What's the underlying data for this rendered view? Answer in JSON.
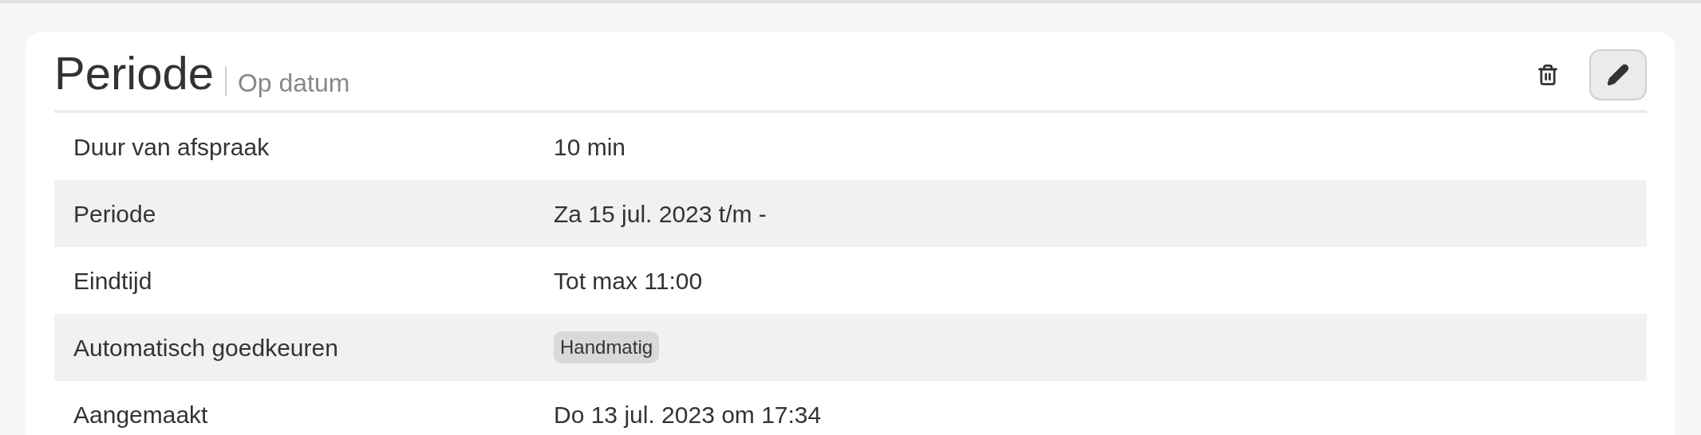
{
  "card": {
    "title": "Periode",
    "subtitle": "Op datum"
  },
  "rows": [
    {
      "label": "Duur van afspraak",
      "kind": "text",
      "value": "10 min"
    },
    {
      "label": "Periode",
      "kind": "text",
      "value": "Za 15 jul. 2023 t/m -"
    },
    {
      "label": "Eindtijd",
      "kind": "text",
      "value": "Tot max 11:00"
    },
    {
      "label": "Automatisch goedkeuren",
      "kind": "badge",
      "value": "Handmatig"
    },
    {
      "label": "Aangemaakt",
      "kind": "text",
      "value": "Do 13 jul. 2023 om 17:34"
    }
  ]
}
